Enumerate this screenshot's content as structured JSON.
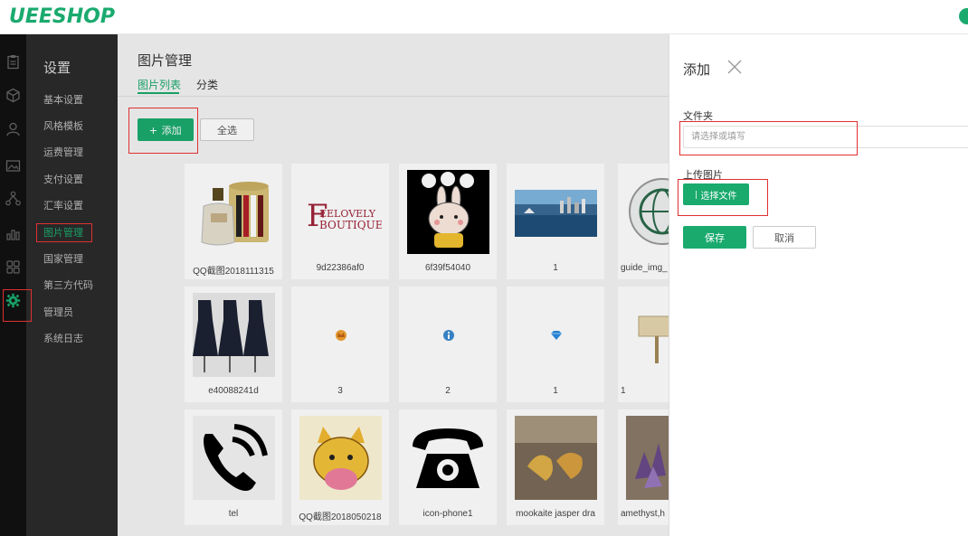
{
  "app": {
    "logo": "UEESHOP"
  },
  "nav": {
    "title": "设置",
    "items": [
      {
        "label": "基本设置",
        "active": false
      },
      {
        "label": "风格模板",
        "active": false
      },
      {
        "label": "运费管理",
        "active": false
      },
      {
        "label": "支付设置",
        "active": false
      },
      {
        "label": "汇率设置",
        "active": false
      },
      {
        "label": "图片管理",
        "active": true
      },
      {
        "label": "国家管理",
        "active": false
      },
      {
        "label": "第三方代码",
        "active": false
      },
      {
        "label": "管理员",
        "active": false
      },
      {
        "label": "系统日志",
        "active": false
      }
    ]
  },
  "rail_icons": [
    "clipboard-icon",
    "cube-icon",
    "user-icon",
    "image-icon",
    "sitemap-icon",
    "bar-chart-icon",
    "grid-icon",
    "settings-gear-icon"
  ],
  "main": {
    "title": "图片管理",
    "tabs": [
      {
        "label": "图片列表",
        "active": true
      },
      {
        "label": "分类",
        "active": false
      }
    ],
    "add_button": "添加",
    "select_all_button": "全选",
    "images": [
      {
        "label": "QQ截图2018111315",
        "thumb": "perfume-image"
      },
      {
        "label": "9d22386af0",
        "thumb": "boutique-logo-image"
      },
      {
        "label": "6f39f54040",
        "thumb": "rabbit-sticker-image"
      },
      {
        "label": "1",
        "thumb": "harbor-photo-image"
      },
      {
        "label": "guide_img_",
        "thumb": "globe-icon-image"
      },
      {
        "label": "e40088241d",
        "thumb": "dresses-photo-image"
      },
      {
        "label": "3",
        "thumb": "crown-icon-image"
      },
      {
        "label": "2",
        "thumb": "info-icon-image"
      },
      {
        "label": "1",
        "thumb": "diamond-icon-image"
      },
      {
        "label": "1",
        "thumb": "sign-icon-image"
      },
      {
        "label": "tel",
        "thumb": "phone-icon-image"
      },
      {
        "label": "QQ截图2018050218",
        "thumb": "cat-sticker-image"
      },
      {
        "label": "icon-phone1",
        "thumb": "telephone-icon-image"
      },
      {
        "label": "mookaite jasper dra",
        "thumb": "dragon-carving-image"
      },
      {
        "label": "amethyst,h",
        "thumb": "amethyst-photo-image"
      }
    ]
  },
  "panel": {
    "title": "添加",
    "folder_label": "文件夹",
    "folder_placeholder": "请选择或填写",
    "upload_label": "上传图片",
    "choose_file_button": "选择文件",
    "save_button": "保存",
    "cancel_button": "取消"
  },
  "colors": {
    "accent": "#1aaa6e",
    "annotation": "#e03030"
  }
}
